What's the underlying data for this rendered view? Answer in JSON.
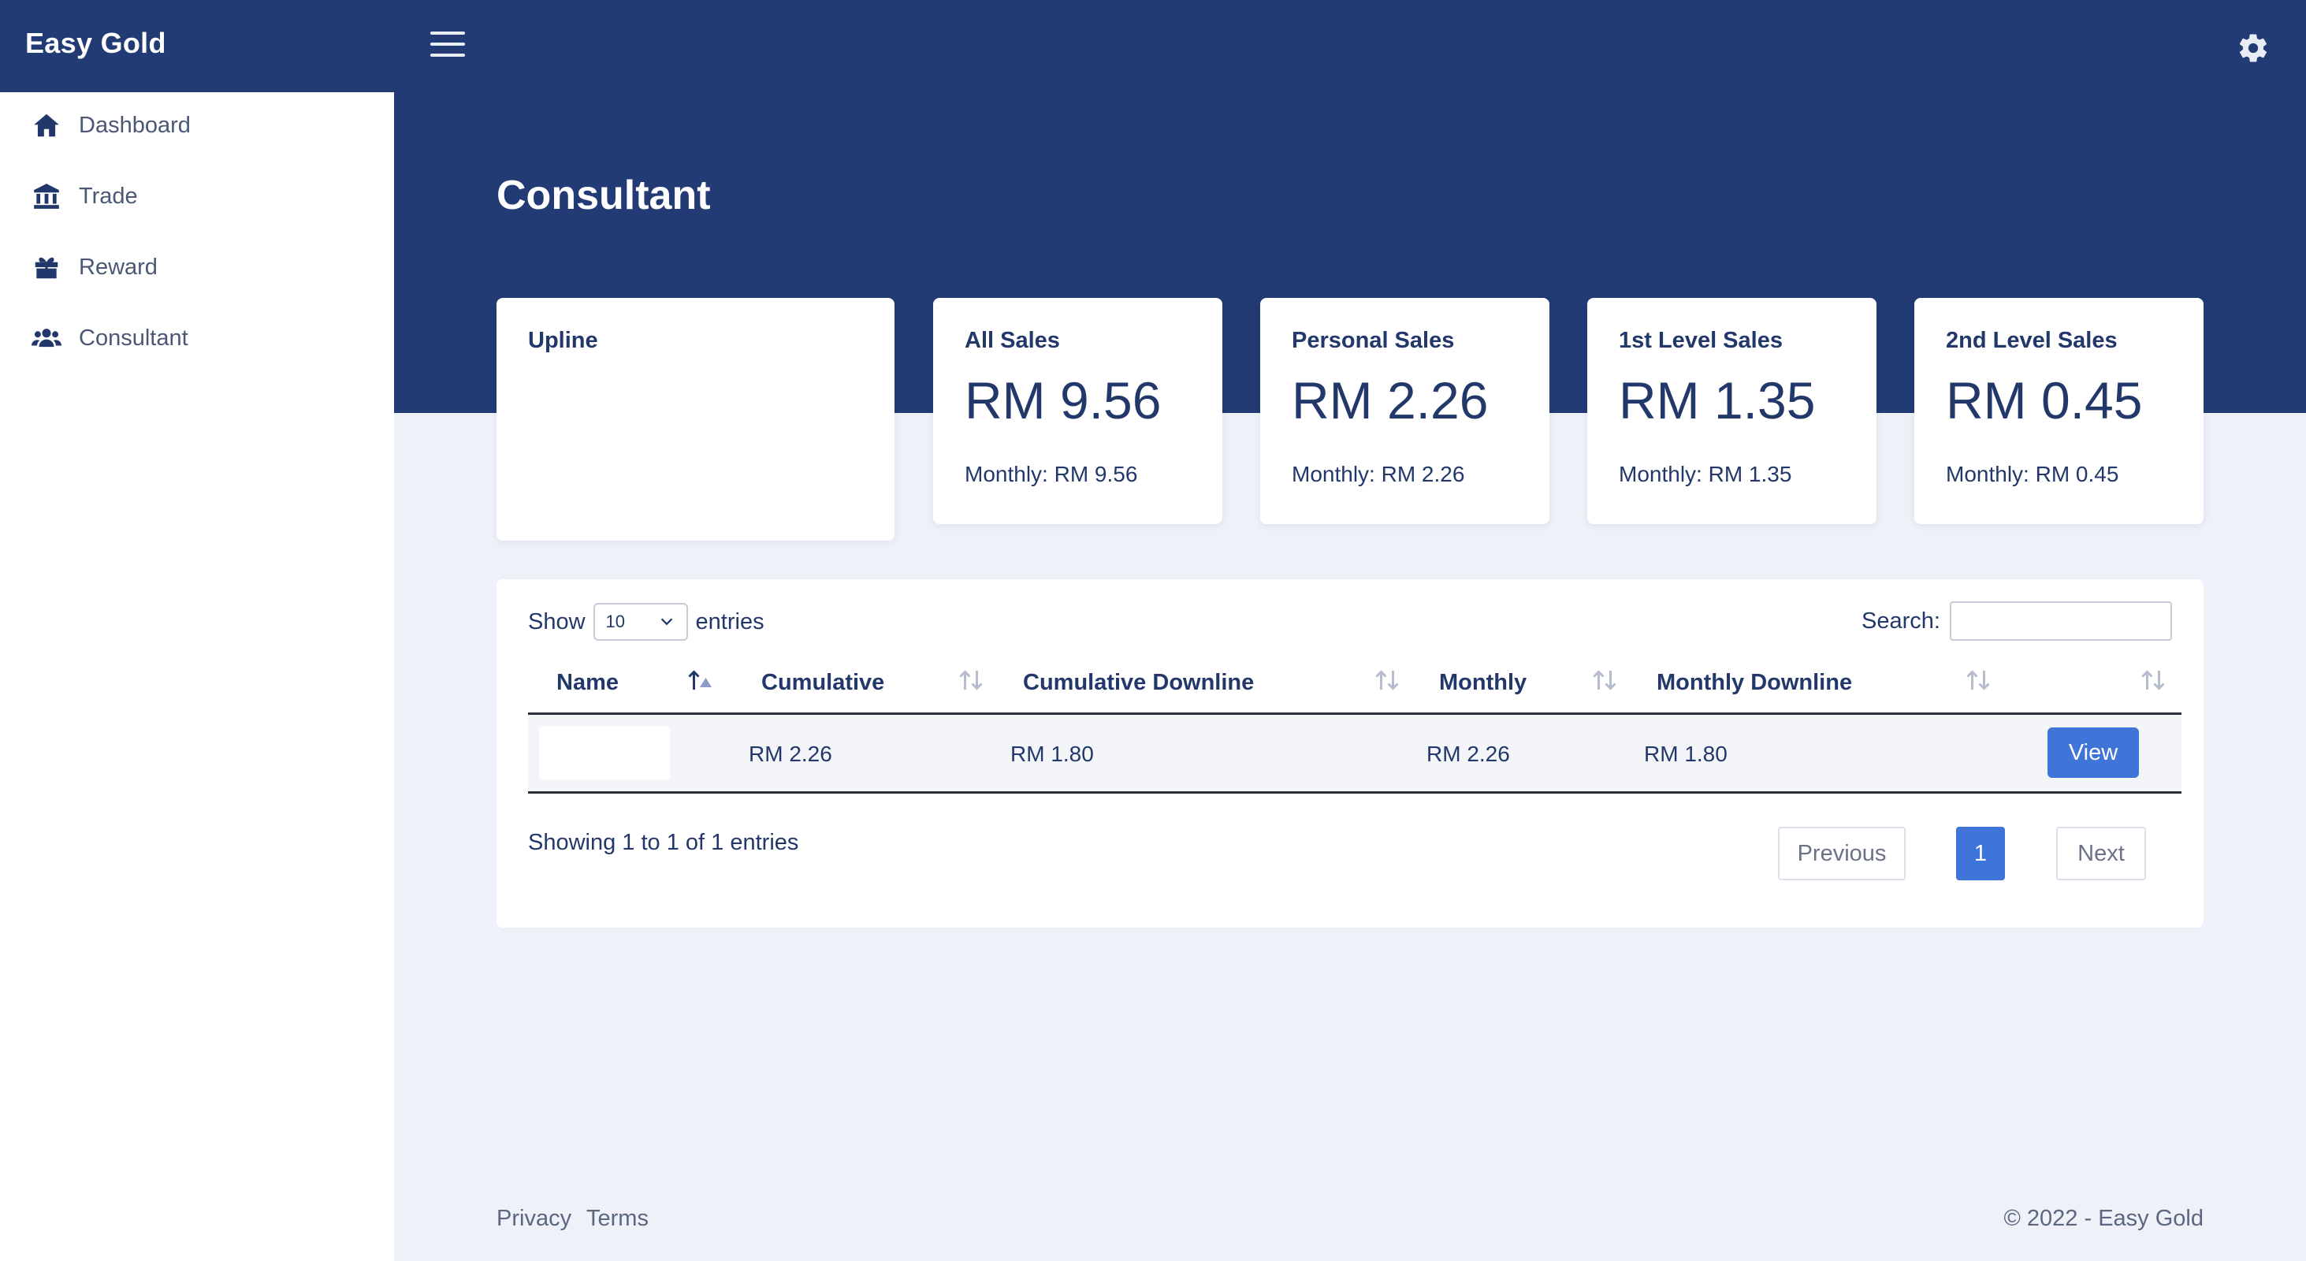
{
  "app": {
    "brand": "Easy Gold"
  },
  "colors": {
    "primary": "#223b74",
    "accent": "#3f74d8",
    "background": "#eef1f7"
  },
  "sidebar": {
    "items": [
      {
        "label": "Dashboard",
        "icon": "home-icon"
      },
      {
        "label": "Trade",
        "icon": "bank-icon"
      },
      {
        "label": "Reward",
        "icon": "gift-icon"
      },
      {
        "label": "Consultant",
        "icon": "users-icon"
      }
    ]
  },
  "header": {
    "menu_icon": "hamburger-icon",
    "settings_icon": "gear-icon"
  },
  "page": {
    "title": "Consultant"
  },
  "cards": {
    "upline": {
      "title": "Upline"
    },
    "all_sales": {
      "title": "All Sales",
      "value": "RM 9.56",
      "monthly": "Monthly: RM 9.56"
    },
    "personal_sales": {
      "title": "Personal Sales",
      "value": "RM 2.26",
      "monthly": "Monthly: RM 2.26"
    },
    "first_level": {
      "title": "1st Level Sales",
      "value": "RM 1.35",
      "monthly": "Monthly: RM 1.35"
    },
    "second_level": {
      "title": "2nd Level Sales",
      "value": "RM 0.45",
      "monthly": "Monthly: RM 0.45"
    }
  },
  "table": {
    "show_label": "Show",
    "entries_label": "entries",
    "page_size": "10",
    "search_label": "Search:",
    "columns": [
      "Name",
      "Cumulative",
      "Cumulative Downline",
      "Monthly",
      "Monthly Downline"
    ],
    "rows": [
      {
        "name": "",
        "cumulative": "RM 2.26",
        "cumulative_downline": "RM 1.80",
        "monthly": "RM 2.26",
        "monthly_downline": "RM 1.80",
        "action": "View"
      }
    ],
    "info": "Showing 1 to 1 of 1 entries",
    "pagination": {
      "previous": "Previous",
      "current": "1",
      "next": "Next"
    }
  },
  "footer": {
    "privacy": "Privacy",
    "terms": "Terms",
    "copyright": "© 2022 - Easy Gold"
  }
}
